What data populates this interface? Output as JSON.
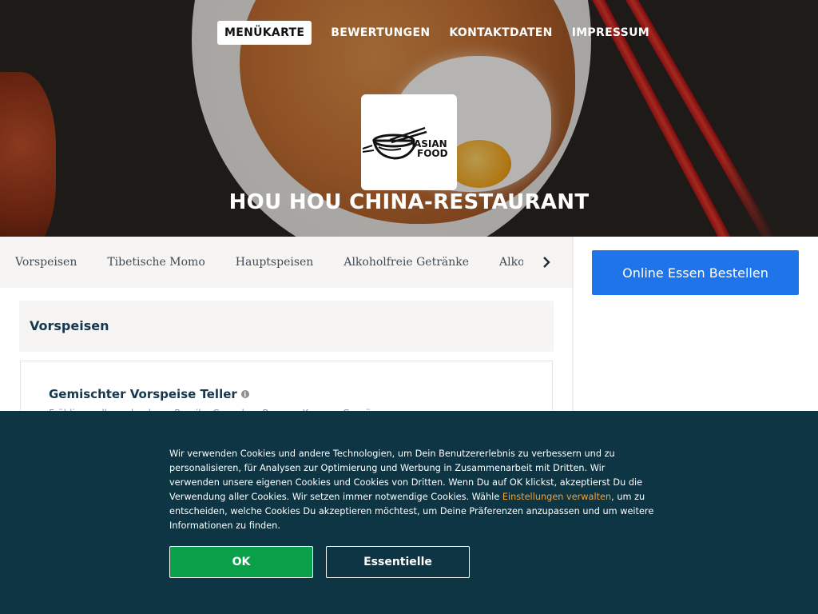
{
  "nav": {
    "items": [
      {
        "label": "MENÜKARTE",
        "active": true
      },
      {
        "label": "BEWERTUNGEN",
        "active": false
      },
      {
        "label": "KONTAKTDATEN",
        "active": false
      },
      {
        "label": "IMPRESSUM",
        "active": false
      }
    ]
  },
  "hero": {
    "logo_line1": "ASIAN",
    "logo_line2": "FOOD",
    "logo_icon": "noodle-bowl-chopsticks-icon",
    "restaurant_name": "HOU HOU CHINA-RESTAURANT"
  },
  "categories": {
    "items": [
      "Vorspeisen",
      "Tibetische Momo",
      "Hauptspeisen",
      "Alkoholfreie Getränke",
      "Alkoholische Getränke"
    ],
    "next_icon": "chevron-right-icon"
  },
  "menu": {
    "section_title": "Vorspeisen",
    "items": [
      {
        "title": "Gemischter Vorspeise Teller",
        "description": "Frühlingsrolle, gebackene Paprika Garnelen, Raupen-Krapen, Gemüse"
      }
    ]
  },
  "order": {
    "button_label": "Online Essen Bestellen",
    "color": "#1e74e8"
  },
  "cookie": {
    "text_before_link": "Wir verwenden Cookies und andere Technologien, um Dein Benutzererlebnis zu verbessern und zu personalisieren, für Analysen zur Optimierung und Werbung in Zusammenarbeit mit Dritten. Wir verwenden unsere eigenen Cookies und Cookies von Dritten. Wenn Du auf OK klickst, akzeptierst Du die Verwendung aller Cookies. Wir setzen immer notwendige Cookies. Wähle ",
    "link_text": "Einstellungen verwalten",
    "text_after_link": ", um zu entscheiden, welche Cookies Du akzeptieren möchtest, um Deine Präferenzen anzupassen und um weitere Informationen zu finden.",
    "ok_label": "OK",
    "essential_label": "Essentielle",
    "background": "#0d3544",
    "ok_color": "#0aa04a",
    "link_color": "#f0a23a"
  }
}
